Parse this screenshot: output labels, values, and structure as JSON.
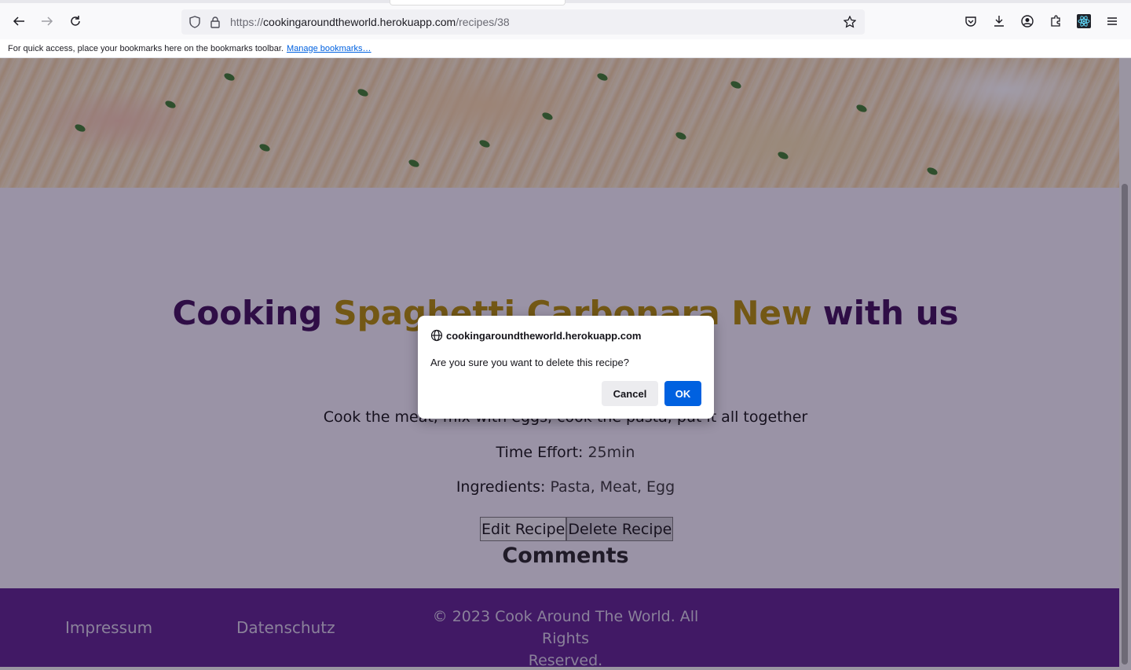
{
  "browser": {
    "url_prefix": "https://",
    "url_host": "cookingaroundtheworld.herokuapp.com",
    "url_path": "/recipes/38",
    "bookmarks_text": "For quick access, place your bookmarks here on the bookmarks toolbar.",
    "bookmarks_link": "Manage bookmarks…"
  },
  "recipe": {
    "title_prefix": "Cooking",
    "name": "Spaghetti Carbonara New",
    "title_suffix": "with us",
    "description": "Cook the meat, mix with eggs, cook the pasta, put it all together",
    "time_label": "Time Effort:",
    "time_value": "25min",
    "ingredients_label": "Ingredients:",
    "ingredients_value": "Pasta, Meat, Egg",
    "edit_label": "Edit Recipe",
    "delete_label": "Delete Recipe",
    "comments_heading": "Comments"
  },
  "footer": {
    "impressum": "Impressum",
    "datenschutz": "Datenschutz",
    "copyright_line1": "© 2023 Cook Around The World. All Rights",
    "copyright_line2": "Reserved."
  },
  "dialog": {
    "host": "cookingaroundtheworld.herokuapp.com",
    "message": "Are you sure you want to delete this recipe?",
    "cancel_label": "Cancel",
    "ok_label": "OK"
  },
  "colors": {
    "accent": "#0061e0",
    "title_purple": "#3b0b55",
    "recipe_name_gold": "#b08a00",
    "footer_purple": "#5a1e8a"
  }
}
